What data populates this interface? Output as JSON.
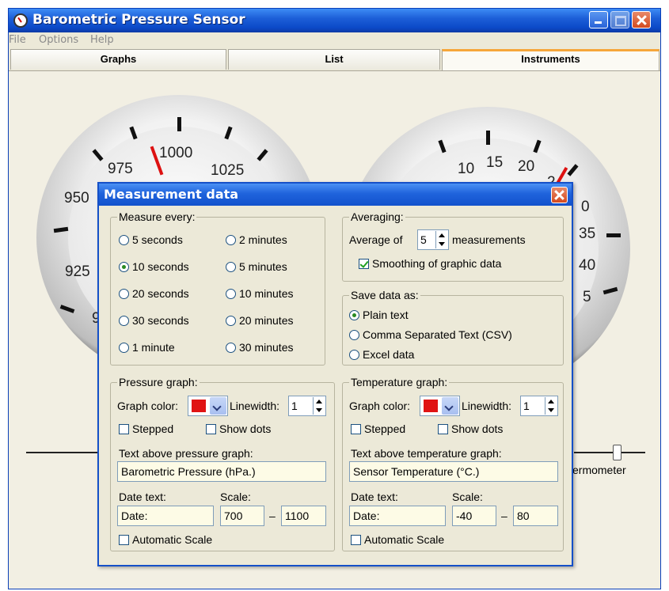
{
  "window": {
    "title": "Barometric Pressure Sensor"
  },
  "menu": [
    "File",
    "Options",
    "Help"
  ],
  "tabs": [
    {
      "label": "Graphs"
    },
    {
      "label": "List"
    },
    {
      "label": "Instruments",
      "active": true
    }
  ],
  "gauges": {
    "pressure_labels": [
      "950",
      "975",
      "1000",
      "1025"
    ],
    "pressure_partial": [
      "925",
      "9"
    ],
    "temp_labels": [
      "5",
      "10",
      "15",
      "20"
    ],
    "temp_partial": [
      "2",
      "0",
      "35",
      "40",
      "5"
    ],
    "thermometer_label": "ermometer"
  },
  "dialog": {
    "title": "Measurement data",
    "measure_every": {
      "title": "Measure every:",
      "options": [
        "5 seconds",
        "10 seconds",
        "20 seconds",
        "30 seconds",
        "1 minute",
        "2 minutes",
        "5 minutes",
        "10 minutes",
        "20 minutes",
        "30 minutes"
      ],
      "selected": "10 seconds"
    },
    "averaging": {
      "title": "Averaging:",
      "prefix": "Average of",
      "value": "5",
      "suffix": "measurements",
      "smoothing_label": "Smoothing of graphic data",
      "smoothing_checked": true
    },
    "save_as": {
      "title": "Save data as:",
      "options": [
        "Plain text",
        "Comma Separated Text (CSV)",
        "Excel data"
      ],
      "selected": "Plain text"
    },
    "pressure_graph": {
      "title": "Pressure graph:",
      "graph_color_label": "Graph color:",
      "color": "#e01313",
      "linewidth_label": "Linewidth:",
      "linewidth": "1",
      "stepped_label": "Stepped",
      "show_dots_label": "Show dots",
      "text_above_label": "Text above pressure graph:",
      "text_above_value": "Barometric Pressure (hPa.)",
      "date_text_label": "Date text:",
      "date_text_value": "Date:",
      "scale_label": "Scale:",
      "scale_min": "700",
      "scale_max": "1100",
      "dash": "–",
      "auto_scale_label": "Automatic Scale"
    },
    "temperature_graph": {
      "title": "Temperature graph:",
      "graph_color_label": "Graph color:",
      "color": "#e01313",
      "linewidth_label": "Linewidth:",
      "linewidth": "1",
      "stepped_label": "Stepped",
      "show_dots_label": "Show dots",
      "text_above_label": "Text above temperature graph:",
      "text_above_value": "Sensor Temperature (°C.)",
      "date_text_label": "Date text:",
      "date_text_value": "Date:",
      "scale_label": "Scale:",
      "scale_min": "-40",
      "scale_max": "80",
      "dash": "–",
      "auto_scale_label": "Automatic Scale"
    }
  }
}
